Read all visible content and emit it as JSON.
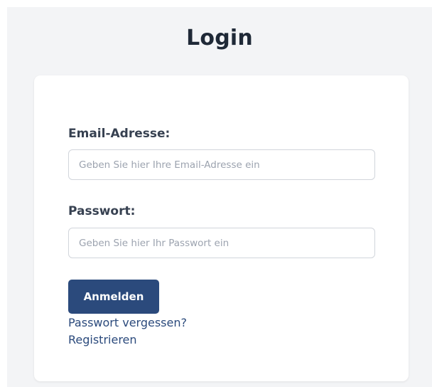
{
  "page": {
    "title": "Login"
  },
  "form": {
    "email_label": "Email-Adresse:",
    "email_placeholder": "Geben Sie hier Ihre Email-Adresse ein",
    "email_value": "",
    "password_label": "Passwort:",
    "password_placeholder": "Geben Sie hier Ihr Passwort ein",
    "password_value": "",
    "submit_label": "Anmelden",
    "forgot_password_link": "Passwort vergessen?",
    "register_link": "Registrieren"
  },
  "colors": {
    "primary": "#2b4a7c",
    "background": "#f3f4f6",
    "card": "#ffffff"
  }
}
